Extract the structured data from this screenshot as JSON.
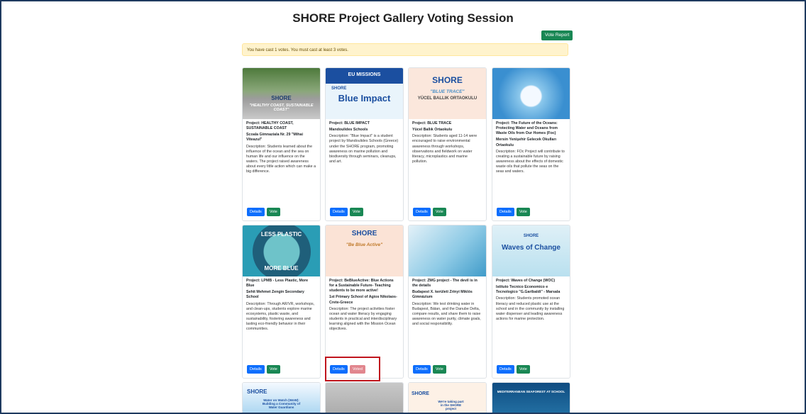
{
  "page": {
    "title": "SHORE Project Gallery Voting Session",
    "vote_report": "Vote Report",
    "alert": "You have cast 1 votes. You must cast at least 3 votes."
  },
  "buttons": {
    "details": "Details",
    "vote": "Vote",
    "voted": "Voted"
  },
  "cards": [
    {
      "project": "Project: HEALTHY COAST, SUSTAINABLE COAST",
      "school": "Scoala Gimnaziala Nr. 29 \"Mihai Viteazul\"",
      "desc": "Description: Students learned about the influence of the ocean and the sea on human life and our influence on the waters. The project raised awareness about every little action which can make a big difference.",
      "img1": "SHORE",
      "img2": "\"HEALTHY COAST, SUSTAINABLE COAST\""
    },
    {
      "project": "Project: BLUE IMPACT",
      "school": "Mandoulides Schools",
      "desc": "Description: \"Blue Impact\" is a student project by Mandoulides Schools (Greece) under the SHORE program, promoting awareness on marine pollution and biodiversity through seminars, cleanups, and art.",
      "img1": "EU MISSIONS",
      "img2": "SHORE",
      "img3": "Blue Impact"
    },
    {
      "project": "Project: BLUE TRACE",
      "school": "Yücel Ballık Ortaokulu",
      "desc": "Description: Students aged 11-14 were encouraged to raise environmental awareness through workshops, observations and fieldwork on water literacy, microplastics and marine pollution.",
      "img1": "SHORE",
      "img2": "\"BLUE TRACE\"",
      "img3": "YÜCEL BALLIK ORTAOKULU"
    },
    {
      "project": "Project: The Future of the Oceans: Protecting Water and Oceans from Waste Oils from Our Homes (Foc)",
      "school": "Mersin Yenişehir Gelecek Okulları Ortaokulu",
      "desc": "Description: FOc Project will contribute to creating a sustainable future by raising awareness about the effects of domestic waste oils that pollute the seas on the seas and waters."
    },
    {
      "project": "Project: LPMB - Less Plastic, More Blue",
      "school": "Sehit Mehmet Zengin Secondary School",
      "desc": "Description: Through AR/VR, workshops, and clean-ups, students explore marine ecosystems, plastic waste, and sustainability, fostering awareness and lasting eco-friendly behavior in their communities.",
      "img1": "LESS PLASTIC",
      "img2": "MORE BLUE"
    },
    {
      "project": "Project: BeBlueActive: Blue Actions for a Sustainable Future- Teaching students to be more active!",
      "school": "1st Primary School of Agios Nikolaos-Crete-Greece",
      "desc": "Description: The project activities foster ocean and water literacy by engaging students in practical and interdisciplinary learning aligned with the Mission Ocean objectives.",
      "img1": "SHORE",
      "img2": "\"Be Blue Active\""
    },
    {
      "project": "Project: ZMG project - The devil is in the details",
      "school": "Budapest X. kerületi Zrínyi Miklós Gimnázium",
      "desc": "Description: We test drinking water in Budapest, Bátan, and the Danube Delta, compare results, and share them to raise awareness on water purity, climate goals, and social responsibility."
    },
    {
      "project": "Project: Waves of Change (WOC)",
      "school": "Istituto Tecnico Economico e Tecnologico \"G.Garibaldi\" - Marsala",
      "desc": "Description: Students promoted ocean literacy and reduced plastic use at the school and in the community by installing water dispenser and leading awareness actions for marine protection.",
      "img1": "SHORE",
      "img2": "Waves of Change"
    }
  ],
  "bottom_thumbs": {
    "t1a": "SHORE",
    "t1b": "Water on Watch (WoW): Building a Community of Water Guardians",
    "t3a": "SHORE",
    "t3b": "We're taking part in the SHORE project",
    "t4a": "MEDITERRANEAN SEAFOREST AT SCHOOL"
  },
  "colors": {
    "details": "#0d6efd",
    "vote": "#198754",
    "voted": "#e1868e",
    "alert_bg": "#fff3cd"
  }
}
